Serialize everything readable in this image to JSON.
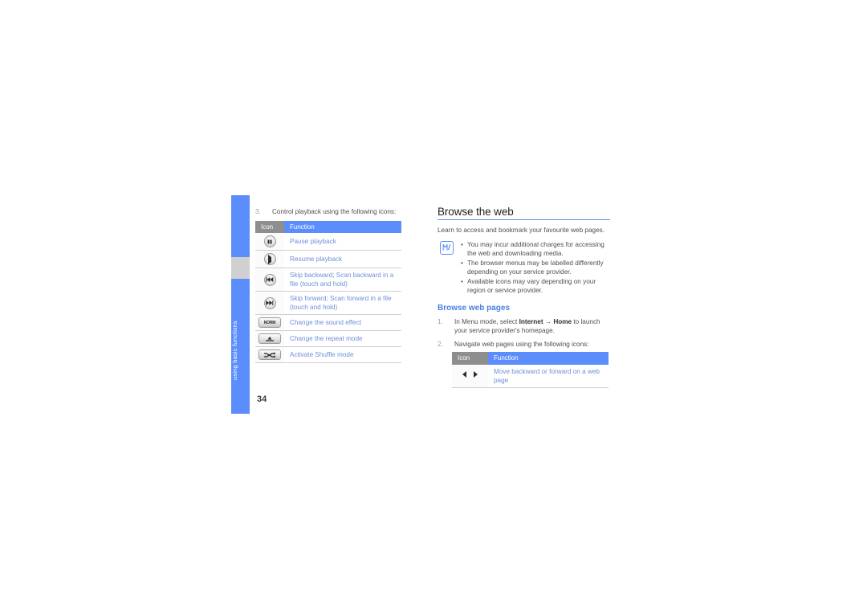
{
  "page": {
    "number": "34",
    "side_tab_label": "using basic functions"
  },
  "left_column": {
    "step": {
      "num": "3.",
      "text": "Control playback using the following icons:"
    },
    "table": {
      "headers": [
        "Icon",
        "Function"
      ],
      "rows": [
        {
          "icon": "pause-button-icon",
          "function": "Pause playback"
        },
        {
          "icon": "play-button-icon",
          "function": "Resume playback"
        },
        {
          "icon": "skip-backward-button-icon",
          "function": "Skip backward; Scan backward in a file (touch and hold)"
        },
        {
          "icon": "skip-forward-button-icon",
          "function": "Skip forward; Scan forward in a file (touch and hold)"
        },
        {
          "icon": "sound-effect-norm-button-icon",
          "icon_label": "NORM",
          "function": "Change the sound effect"
        },
        {
          "icon": "repeat-mode-button-icon",
          "function": "Change the repeat mode"
        },
        {
          "icon": "shuffle-mode-button-icon",
          "function": "Activate Shuffle mode"
        }
      ]
    }
  },
  "right_column": {
    "heading": "Browse the web",
    "lead": "Learn to access and bookmark your favourite web pages.",
    "note": {
      "icon": "note-pencil-icon",
      "items": [
        "You may incur additional charges for accessing the web and downloading media.",
        "The browser menus may be labelled differently depending on your service provider.",
        "Available icons may vary depending on your region or service provider."
      ]
    },
    "subheading": "Browse web pages",
    "steps": [
      {
        "num": "1.",
        "text_before": "In Menu mode, select ",
        "bold_1": "Internet",
        "arrow": " → ",
        "bold_2": "Home",
        "text_after": " to launch your service provider's homepage."
      },
      {
        "num": "2.",
        "text": "Navigate web pages using the following icons:"
      }
    ],
    "table": {
      "headers": [
        "Icon",
        "Function"
      ],
      "rows": [
        {
          "icon": "back-forward-arrows-icon",
          "function": "Move backward or forward on a web page"
        }
      ]
    }
  },
  "colors": {
    "accent_blue": "#5b8dfc",
    "link_blue": "#6f8fd6",
    "heading_blue": "#4a7fe0",
    "header_grey": "#8e8e8e",
    "body_grey": "#4f4f4f",
    "notch_grey": "#d0d0d0"
  }
}
